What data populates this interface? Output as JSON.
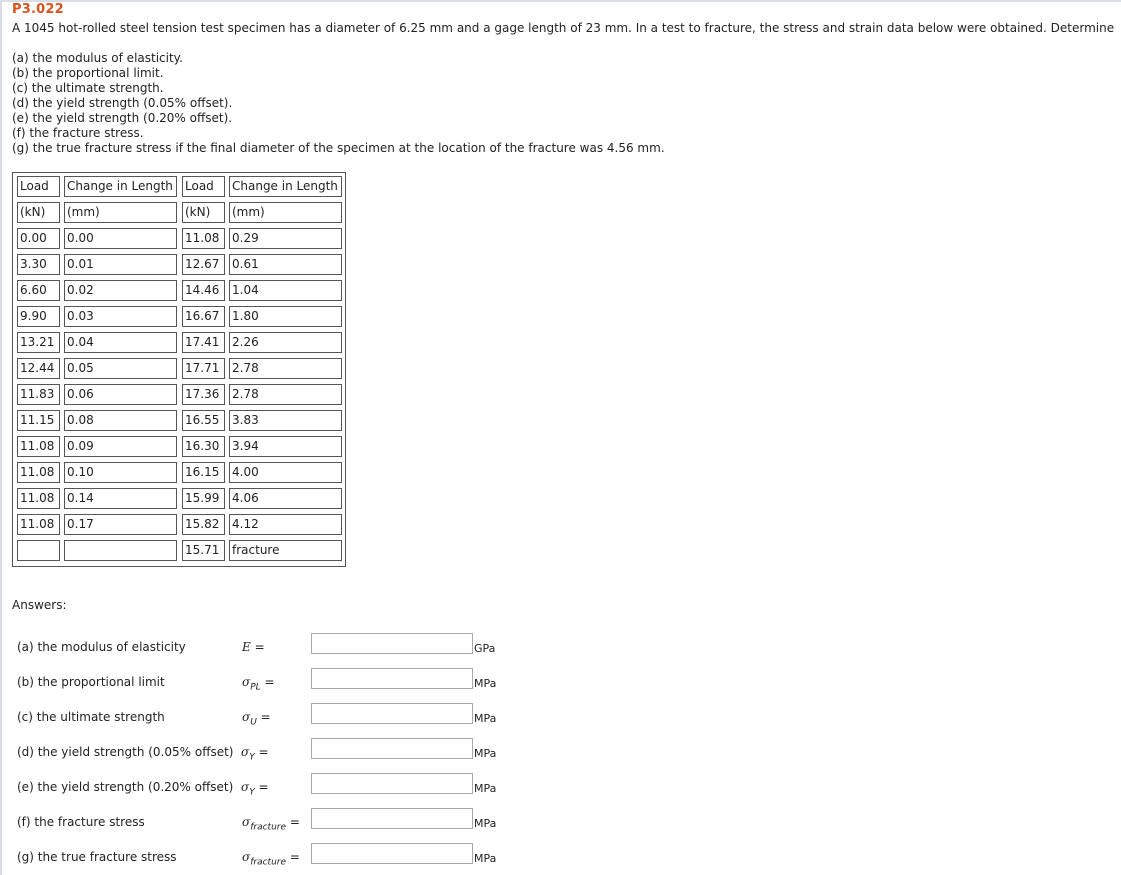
{
  "problem": {
    "id": "P3.022",
    "statement": "A 1045 hot-rolled steel tension test specimen has a diameter of 6.25 mm and a gage length of 23 mm. In a test to fracture, the stress and strain data below were obtained. Determine",
    "parts": [
      "(a) the modulus of elasticity.",
      "(b) the proportional limit.",
      "(c) the ultimate strength.",
      "(d) the yield strength (0.05% offset).",
      "(e) the yield strength (0.20% offset).",
      "(f) the fracture stress.",
      "(g) the true fracture stress if the final diameter of the specimen at the location of the fracture was 4.56 mm."
    ]
  },
  "table": {
    "headers": [
      "Load",
      "Change in Length",
      "Load",
      "Change in Length"
    ],
    "units": [
      "(kN)",
      "(mm)",
      "(kN)",
      "(mm)"
    ],
    "rows": [
      [
        "0.00",
        "0.00",
        "11.08",
        "0.29"
      ],
      [
        "3.30",
        "0.01",
        "12.67",
        "0.61"
      ],
      [
        "6.60",
        "0.02",
        "14.46",
        "1.04"
      ],
      [
        "9.90",
        "0.03",
        "16.67",
        "1.80"
      ],
      [
        "13.21",
        "0.04",
        "17.41",
        "2.26"
      ],
      [
        "12.44",
        "0.05",
        "17.71",
        "2.78"
      ],
      [
        "11.83",
        "0.06",
        "17.36",
        "2.78"
      ],
      [
        "11.15",
        "0.08",
        "16.55",
        "3.83"
      ],
      [
        "11.08",
        "0.09",
        "16.30",
        "3.94"
      ],
      [
        "11.08",
        "0.10",
        "16.15",
        "4.00"
      ],
      [
        "11.08",
        "0.14",
        "15.99",
        "4.06"
      ],
      [
        "11.08",
        "0.17",
        "15.82",
        "4.12"
      ],
      [
        "",
        "",
        "15.71",
        "fracture"
      ]
    ]
  },
  "answers": {
    "label": "Answers:",
    "items": [
      {
        "text": "(a) the modulus of elasticity",
        "symbol": "E",
        "sub": "",
        "eq": " =",
        "value": "",
        "unit": "GPa"
      },
      {
        "text": "(b) the proportional limit",
        "symbol": "σ",
        "sub": "PL",
        "eq": " =",
        "value": "",
        "unit": "MPa"
      },
      {
        "text": "(c) the ultimate strength",
        "symbol": "σ",
        "sub": "U",
        "eq": " =",
        "value": "",
        "unit": "MPa"
      },
      {
        "text": "(d) the yield strength (0.05% offset)",
        "symbol": "σ",
        "sub": "Y",
        "eq": " =",
        "value": "",
        "unit": "MPa"
      },
      {
        "text": "(e) the yield strength (0.20% offset)",
        "symbol": "σ",
        "sub": "Y",
        "eq": " =",
        "value": "",
        "unit": "MPa"
      },
      {
        "text": "(f)  the fracture stress",
        "symbol": "σ",
        "sub": "fracture",
        "eq": " =",
        "value": "",
        "unit": "MPa"
      },
      {
        "text": "(g)  the true fracture stress",
        "symbol": "σ",
        "sub": "fracture",
        "eq": " =",
        "value": "",
        "unit": "MPa"
      }
    ]
  }
}
